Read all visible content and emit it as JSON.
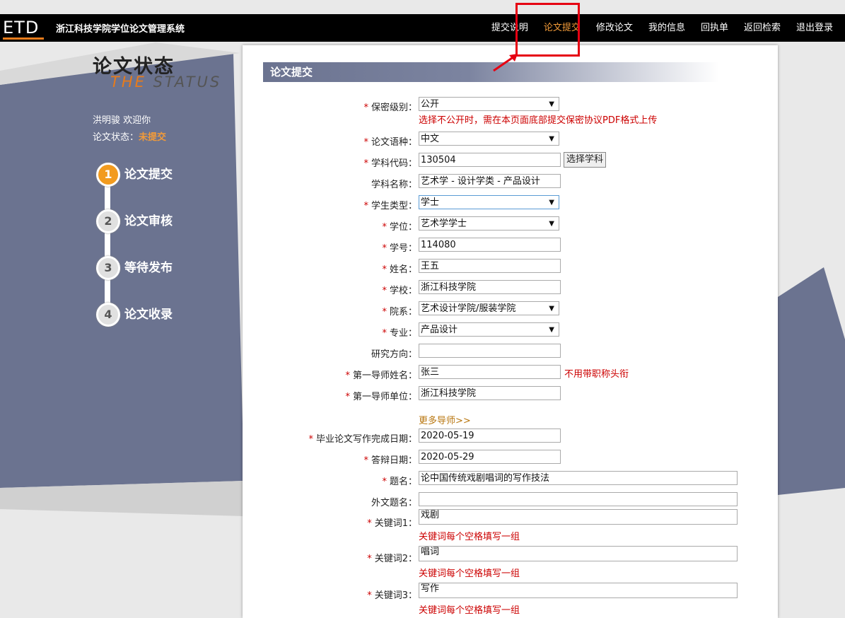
{
  "header": {
    "logo": "ETD",
    "site_title": "浙江科技学院学位论文管理系统",
    "nav": [
      "提交说明",
      "论文提交",
      "修改论文",
      "我的信息",
      "回执单",
      "返回检索",
      "退出登录"
    ],
    "active_index": 1
  },
  "sidebar": {
    "title": "论文状态",
    "subtitle_the": "THE",
    "subtitle_rest": "STATUS",
    "welcome": "洪明骏 欢迎你",
    "state_label": "论文状态：",
    "state_value": "未提交",
    "steps": [
      {
        "num": "1",
        "label": "论文提交"
      },
      {
        "num": "2",
        "label": "论文审核"
      },
      {
        "num": "3",
        "label": "等待发布"
      },
      {
        "num": "4",
        "label": "论文收录"
      }
    ],
    "current_step": 1
  },
  "form": {
    "section_title": "论文提交",
    "secrecy": {
      "label": "保密级别：",
      "value": "公开",
      "hint": "选择不公开时，需在本页面底部提交保密协议PDF格式上传"
    },
    "language": {
      "label": "论文语种：",
      "value": "中文"
    },
    "subject_code": {
      "label": "学科代码：",
      "value": "130504",
      "button": "选择学科"
    },
    "subject_name": {
      "label": "学科名称：",
      "value": "艺术学 - 设计学类 - 产品设计"
    },
    "student_type": {
      "label": "学生类型：",
      "value": "学士"
    },
    "degree": {
      "label": "学位：",
      "value": "艺术学学士"
    },
    "student_id": {
      "label": "学号：",
      "value": "114080"
    },
    "name": {
      "label": "姓名：",
      "value": "王五"
    },
    "school": {
      "label": "学校：",
      "value": "浙江科技学院"
    },
    "department": {
      "label": "院系：",
      "value": "艺术设计学院/服装学院"
    },
    "major": {
      "label": "专业：",
      "value": "产品设计"
    },
    "research": {
      "label": "研究方向：",
      "value": ""
    },
    "advisor_name": {
      "label": "第一导师姓名：",
      "value": "张三",
      "hint": "不用带职称头衔"
    },
    "advisor_unit": {
      "label": "第一导师单位：",
      "value": "浙江科技学院"
    },
    "more_advisors": "更多导师>>",
    "finish_date": {
      "label": "毕业论文写作完成日期：",
      "value": "2020-05-19"
    },
    "defense_date": {
      "label": "答辩日期：",
      "value": "2020-05-29"
    },
    "title": {
      "label": "题名：",
      "value": "论中国传统戏剧唱词的写作技法"
    },
    "foreign_title": {
      "label": "外文题名：",
      "value": ""
    },
    "keyword_hint": "关键词每个空格填写一组",
    "keyword1": {
      "label": "关键词1：",
      "value": "戏剧"
    },
    "keyword2": {
      "label": "关键词2：",
      "value": "唱词"
    },
    "keyword3": {
      "label": "关键词3：",
      "value": "写作"
    },
    "required_mark": "*"
  },
  "colors": {
    "accent": "#f29b39",
    "panel": "#6b7390",
    "required": "#cc0000",
    "callout": "#e60012"
  }
}
